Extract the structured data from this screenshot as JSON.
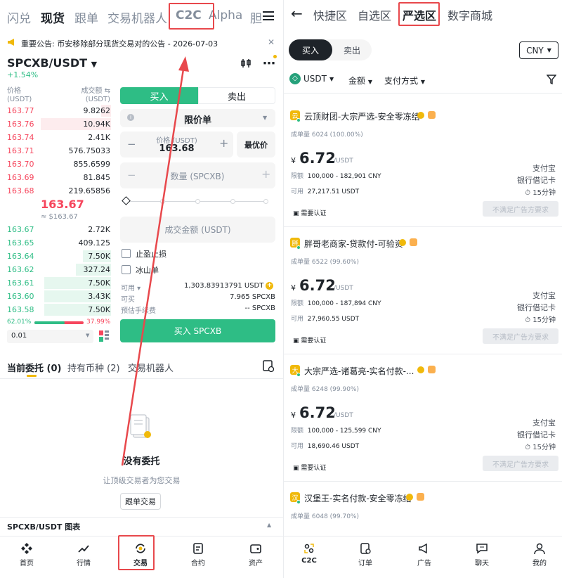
{
  "left": {
    "topnav": {
      "items": [
        "闪兑",
        "现货",
        "跟单",
        "交易机器人",
        "C2C",
        "Alpha",
        "胆"
      ],
      "active": "现货"
    },
    "notice": {
      "text": "重要公告: 币安移除部分现货交易对的公告 - 2026-07-03"
    },
    "pair": {
      "name": "SPCXB/USDT",
      "change": "+1.54%"
    },
    "orderbook": {
      "price_header": "价格",
      "price_unit": "(USDT)",
      "qty_header": "成交额",
      "qty_unit": "(USDT)",
      "asks": [
        {
          "price": "163.77",
          "qty": "9.8262"
        },
        {
          "price": "163.76",
          "qty": "10.94K"
        },
        {
          "price": "163.74",
          "qty": "2.41K"
        },
        {
          "price": "163.71",
          "qty": "576.75033"
        },
        {
          "price": "163.70",
          "qty": "855.6599"
        },
        {
          "price": "163.69",
          "qty": "81.845"
        },
        {
          "price": "163.68",
          "qty": "219.65856"
        }
      ],
      "last_price": "163.67",
      "last_fiat": "≈ $163.67",
      "bids": [
        {
          "price": "163.67",
          "qty": "2.72K"
        },
        {
          "price": "163.65",
          "qty": "409.125"
        },
        {
          "price": "163.64",
          "qty": "7.50K"
        },
        {
          "price": "163.62",
          "qty": "327.24"
        },
        {
          "price": "163.61",
          "qty": "7.50K"
        },
        {
          "price": "163.60",
          "qty": "3.43K"
        },
        {
          "price": "163.58",
          "qty": "7.50K"
        }
      ],
      "buy_pct": "62.01%",
      "sell_pct": "37.99%",
      "buy_ratio": 0.6201,
      "precision": "0.01"
    },
    "form": {
      "buy_tab": "买入",
      "sell_tab": "卖出",
      "order_type": "限价单",
      "price_label": "价格 (USDT)",
      "price_value": "163.68",
      "best_price": "最优价",
      "qty_placeholder": "数量 (SPCXB)",
      "total_placeholder": "成交金额 (USDT)",
      "tp_sl": "止盈止损",
      "iceberg": "冰山单",
      "available_label": "可用",
      "available_value": "1,303.83913791 USDT",
      "can_buy_label": "可买",
      "can_buy_value": "7.965 SPCXB",
      "fee_label": "预估手续费",
      "fee_value": "-- SPCXB",
      "submit": "买入 SPCXB"
    },
    "orders_tabs": [
      "当前委托 (0)",
      "持有币种 (2)",
      "交易机器人"
    ],
    "empty": {
      "title": "没有委托",
      "subtitle": "让顶级交易者为您交易",
      "button": "跟单交易"
    },
    "chart_bar": "SPCXB/USDT 图表",
    "bottomnav": [
      {
        "label": "首页",
        "icon": "home-icon"
      },
      {
        "label": "行情",
        "icon": "markets-icon"
      },
      {
        "label": "交易",
        "icon": "trade-icon"
      },
      {
        "label": "合约",
        "icon": "futures-icon"
      },
      {
        "label": "资产",
        "icon": "assets-icon"
      }
    ]
  },
  "right": {
    "topnav": {
      "items": [
        "快捷区",
        "自选区",
        "严选区",
        "数字商城"
      ],
      "active": "严选区"
    },
    "buy_tab": "买入",
    "sell_tab": "卖出",
    "currency": "CNY",
    "filters": {
      "coin": "USDT",
      "amount": "金额",
      "payment": "支付方式"
    },
    "cards": [
      {
        "avatar": "云",
        "name": "云顶财团-大宗严选-安全零冻结",
        "volume_label": "成单量",
        "volume": "6024 (100.00%)",
        "currency_symbol": "¥",
        "price": "6.72",
        "unit": "/USDT",
        "limit_label": "限额",
        "limit": "100,000 - 182,901 CNY",
        "avail_label": "可用",
        "avail": "27,217.51 USDT",
        "pay1": "支付宝",
        "pay2": "银行借记卡",
        "time": "15分钟",
        "tag": "需要认证",
        "button": "不满足广告方要求"
      },
      {
        "avatar": "胖",
        "name": "胖哥老商家-贷款付-可验资",
        "volume_label": "成单量",
        "volume": "6522 (99.60%)",
        "currency_symbol": "¥",
        "price": "6.72",
        "unit": "/USDT",
        "limit_label": "限额",
        "limit": "100,000 - 187,894 CNY",
        "avail_label": "可用",
        "avail": "27,960.55 USDT",
        "pay1": "支付宝",
        "pay2": "银行借记卡",
        "time": "15分钟",
        "tag": "需要认证",
        "button": "不满足广告方要求"
      },
      {
        "avatar": "大",
        "name": "大宗严选-诸葛亮-实名付款-...",
        "volume_label": "成单量",
        "volume": "6248 (99.90%)",
        "currency_symbol": "¥",
        "price": "6.72",
        "unit": "/USDT",
        "limit_label": "限额",
        "limit": "100,000 - 125,599 CNY",
        "avail_label": "可用",
        "avail": "18,690.46 USDT",
        "pay1": "支付宝",
        "pay2": "银行借记卡",
        "time": "15分钟",
        "tag": "需要认证",
        "button": "不满足广告方要求"
      },
      {
        "avatar": "汉",
        "name": "汉堡王-实名付款-安全零冻结",
        "volume_label": "成单量",
        "volume": "6048 (99.70%)"
      }
    ],
    "bottomnav": [
      {
        "label": "C2C",
        "icon": "c2c-icon"
      },
      {
        "label": "订单",
        "icon": "orders-icon"
      },
      {
        "label": "广告",
        "icon": "ads-icon"
      },
      {
        "label": "聊天",
        "icon": "chat-icon"
      },
      {
        "label": "我的",
        "icon": "profile-icon"
      }
    ]
  },
  "colors": {
    "accent_red": "#e8484c",
    "buy_green": "#2ebd85",
    "sell_red": "#f6465d",
    "brand_yellow": "#f0b90b"
  }
}
